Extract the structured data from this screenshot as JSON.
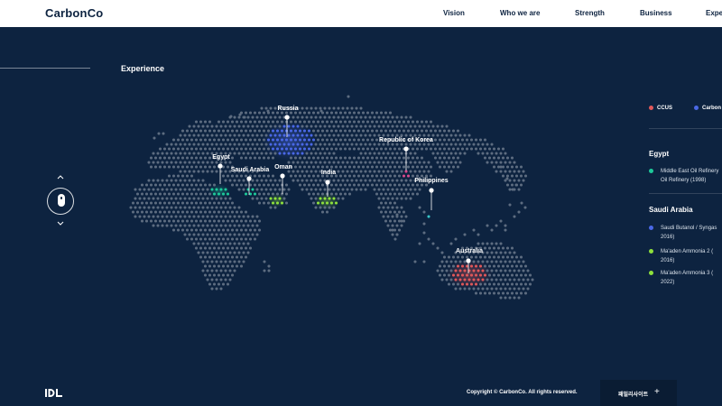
{
  "header": {
    "logo": "CarbonCo",
    "nav": [
      "Vision",
      "Who we are",
      "Strength",
      "Business",
      "Experience"
    ]
  },
  "section": {
    "title": "Experience"
  },
  "map": {
    "pins": [
      {
        "label": "Russia"
      },
      {
        "label": "Republic of Korea"
      },
      {
        "label": "Egypt"
      },
      {
        "label": "Saudi Arabia"
      },
      {
        "label": "Oman"
      },
      {
        "label": "India"
      },
      {
        "label": "Philippines"
      },
      {
        "label": "Australia"
      }
    ]
  },
  "legend": {
    "items": [
      {
        "label": "CCUS",
        "color": "#e0585a"
      },
      {
        "label": "Carbon",
        "color": "#4a68e6"
      }
    ]
  },
  "panel": {
    "countries": [
      {
        "name": "Egypt",
        "projects": [
          {
            "text": "Middle East Oil Refinery\nOil Refinery (1998)",
            "color": "#1ec99a"
          }
        ]
      },
      {
        "name": "Saudi Arabia",
        "projects": [
          {
            "text": "Saudi Butanol / Syngas\n2016)",
            "color": "#4a68e6"
          },
          {
            "text": "Ma'aden Ammonia 2 (\n2016)",
            "color": "#8ee03c"
          },
          {
            "text": "Ma'aden Ammonia 3 (\n2022)",
            "color": "#8ee03c"
          }
        ]
      }
    ]
  },
  "footer": {
    "copyright": "Copyright © CarbonCo. All rights reserved.",
    "family_site": "패밀리사이트"
  },
  "colors": {
    "background": "#0d2340",
    "dot": "#5d6c80",
    "ccus": "#e0585a",
    "carbon": "#4a68e6",
    "teal": "#1ec99a",
    "green": "#8ee03c",
    "pink": "#d84b8c",
    "cyan": "#38c7c9"
  }
}
